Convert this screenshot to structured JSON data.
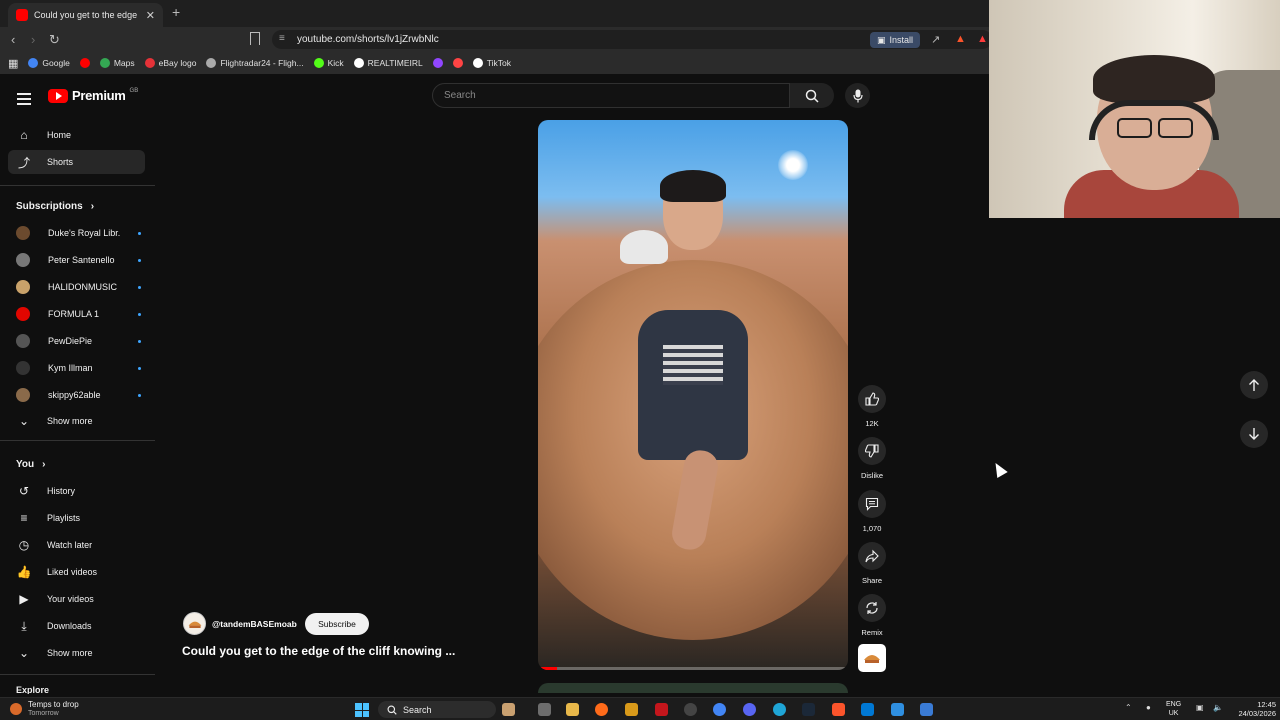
{
  "browser": {
    "tab_title": "Could you get to the edge of",
    "tab_close": "✕",
    "new_tab": "+",
    "url": "youtube.com/shorts/lv1jZrwbNlc",
    "install_label": "Install",
    "bookmarks": [
      {
        "label": "Google",
        "color": "#4285f4"
      },
      {
        "label": "",
        "color": "#ff0000"
      },
      {
        "label": "Maps",
        "color": "#34a853"
      },
      {
        "label": "eBay logo",
        "color": "#e53238"
      },
      {
        "label": "Flightradar24 - Fligh...",
        "color": "#aaaaaa"
      },
      {
        "label": "Kick",
        "color": "#53fc18"
      },
      {
        "label": "REALTIMEIRL",
        "color": "#ffffff"
      },
      {
        "label": "",
        "color": "#9146ff"
      },
      {
        "label": "",
        "color": "#ff4444"
      },
      {
        "label": "TikTok",
        "color": "#ffffff"
      }
    ]
  },
  "youtube": {
    "logo_text": "Premium",
    "logo_region": "GB",
    "search_placeholder": "Search",
    "nav": {
      "home": "Home",
      "shorts": "Shorts"
    },
    "subscriptions_title": "Subscriptions",
    "subscriptions": [
      {
        "name": "Duke's Royal Libr...",
        "color": "#6b4a2e"
      },
      {
        "name": "Peter Santenello",
        "color": "#777777"
      },
      {
        "name": "HALIDONMUSIC",
        "color": "#c9a26a"
      },
      {
        "name": "FORMULA 1",
        "color": "#e10600"
      },
      {
        "name": "PewDiePie",
        "color": "#555555"
      },
      {
        "name": "Kym Illman",
        "color": "#333333"
      },
      {
        "name": "skippy62able",
        "color": "#8a6a4a"
      }
    ],
    "show_more_subs": "Show more",
    "you_title": "You",
    "you_items": {
      "history": "History",
      "playlists": "Playlists",
      "watch_later": "Watch later",
      "liked": "Liked videos",
      "your_videos": "Your videos",
      "downloads": "Downloads",
      "show_more": "Show more"
    },
    "explore_partial": "Explore"
  },
  "short": {
    "channel_handle": "@tandemBASEmoab",
    "subscribe_label": "Subscribe",
    "title": "Could you get to the edge of the cliff knowing ...",
    "progress": 0.06,
    "actions": {
      "like_count": "12K",
      "dislike_label": "Dislike",
      "comment_count": "1,070",
      "share_label": "Share",
      "remix_label": "Remix"
    }
  },
  "taskbar": {
    "weather_line1": "Temps to drop",
    "weather_line2": "Tomorrow",
    "search_label": "Search",
    "lang_line1": "ENG",
    "lang_line2": "UK",
    "time": "12:45",
    "date": "24/03/2026"
  },
  "colors": {
    "accent": "#ff0000",
    "background": "#0f0f0f",
    "subscription_dot": "#3ea6ff"
  }
}
